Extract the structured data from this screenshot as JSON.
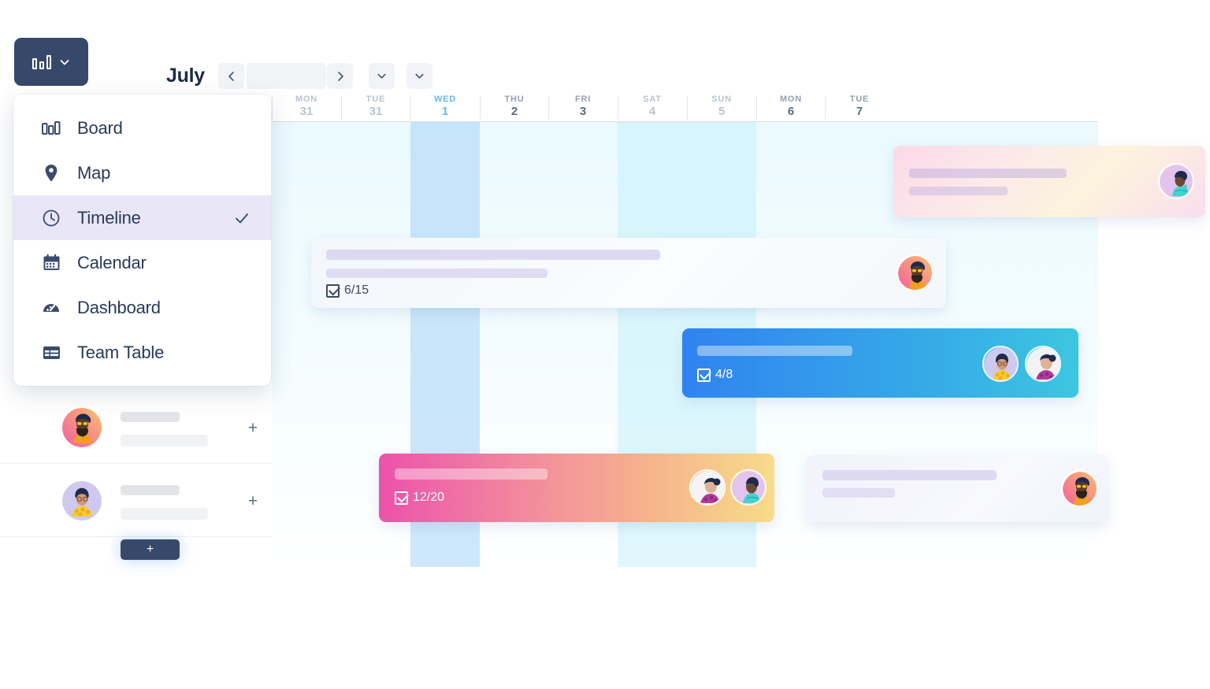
{
  "toolbar": {
    "view_trigger": {
      "icon": "board-icon",
      "chevron": "chevron-down-icon"
    },
    "month_label": "July",
    "prev_label": "‹",
    "next_label": "›",
    "range_placeholder": "",
    "dropdown_1": "⌄",
    "dropdown_2": "⌄"
  },
  "view_menu": {
    "items": [
      {
        "label": "Board",
        "icon": "board-icon",
        "selected": false
      },
      {
        "label": "Map",
        "icon": "pin-icon",
        "selected": false
      },
      {
        "label": "Timeline",
        "icon": "clock-icon",
        "selected": true
      },
      {
        "label": "Calendar",
        "icon": "calendar-icon",
        "selected": false
      },
      {
        "label": "Dashboard",
        "icon": "gauge-icon",
        "selected": false
      },
      {
        "label": "Team Table",
        "icon": "table-icon",
        "selected": false
      }
    ],
    "check_icon": "check-icon"
  },
  "timeline": {
    "days": [
      {
        "dow": "MON",
        "num": "31",
        "state": "muted"
      },
      {
        "dow": "TUE",
        "num": "31",
        "state": "muted"
      },
      {
        "dow": "WED",
        "num": "1",
        "state": "today"
      },
      {
        "dow": "THU",
        "num": "2",
        "state": "strong"
      },
      {
        "dow": "FRI",
        "num": "3",
        "state": "strong"
      },
      {
        "dow": "SAT",
        "num": "4",
        "state": "weekend"
      },
      {
        "dow": "SUN",
        "num": "5",
        "state": "weekend"
      },
      {
        "dow": "MON",
        "num": "6",
        "state": "strong"
      },
      {
        "dow": "TUE",
        "num": "7",
        "state": "strong"
      }
    ],
    "cards": [
      {
        "id": "card-pink-tr",
        "progress": "",
        "avatars": 1
      },
      {
        "id": "card-white-1",
        "progress": "6/15",
        "avatars": 1
      },
      {
        "id": "card-blue",
        "progress": "4/8",
        "avatars": 2
      },
      {
        "id": "card-pinkyel",
        "progress": "12/20",
        "avatars": 2
      },
      {
        "id": "card-white-2",
        "progress": "",
        "avatars": 1
      }
    ]
  },
  "left_panel": {
    "rows": [
      {
        "plus_label": "+"
      },
      {
        "plus_label": "+"
      }
    ],
    "add_button_label": "+"
  },
  "colors": {
    "navy": "#37496b",
    "selected_row": "#e9e6f8",
    "today_blue": "#63b8ef",
    "accent_blue": "#3183f0",
    "accent_pink": "#ec52ab"
  }
}
